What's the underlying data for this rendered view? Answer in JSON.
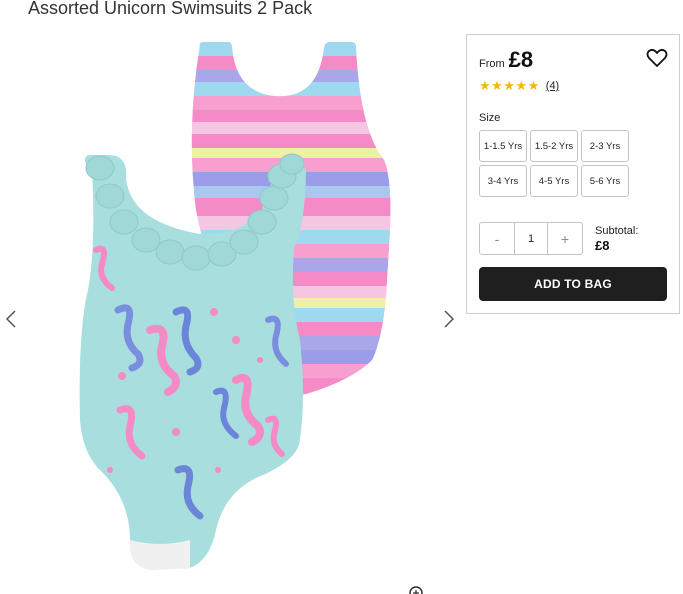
{
  "product": {
    "title": "Assorted Unicorn Swimsuits 2 Pack"
  },
  "gallery": {
    "image_alt": "Two children's swimsuits: a rainbow stripe swimsuit and a mint seahorse print swimsuit with ruffle neckline",
    "prev_icon": "chevron-left-icon",
    "next_icon": "chevron-right-icon",
    "zoom_icon": "zoom-icon"
  },
  "purchase": {
    "from_label": "From",
    "price": "£8",
    "wishlist_icon": "heart-outline-icon",
    "rating": {
      "stars": 5,
      "count": "(4)"
    },
    "size_label": "Size",
    "sizes": [
      "1-1.5 Yrs",
      "1.5-2 Yrs",
      "2-3 Yrs",
      "3-4 Yrs",
      "4-5 Yrs",
      "5-6 Yrs"
    ],
    "quantity": {
      "minus": "-",
      "value": "1",
      "plus": "+"
    },
    "subtotal_label": "Subtotal:",
    "subtotal_value": "£8",
    "add_to_bag": "ADD TO BAG"
  },
  "colors": {
    "button_bg": "#1f1f1f",
    "star": "#f5b800",
    "mint": "#a8dede",
    "pink": "#f48bc6",
    "lilac": "#9c9de8",
    "sky": "#8fd3f0",
    "lemon": "#eef0a8"
  }
}
